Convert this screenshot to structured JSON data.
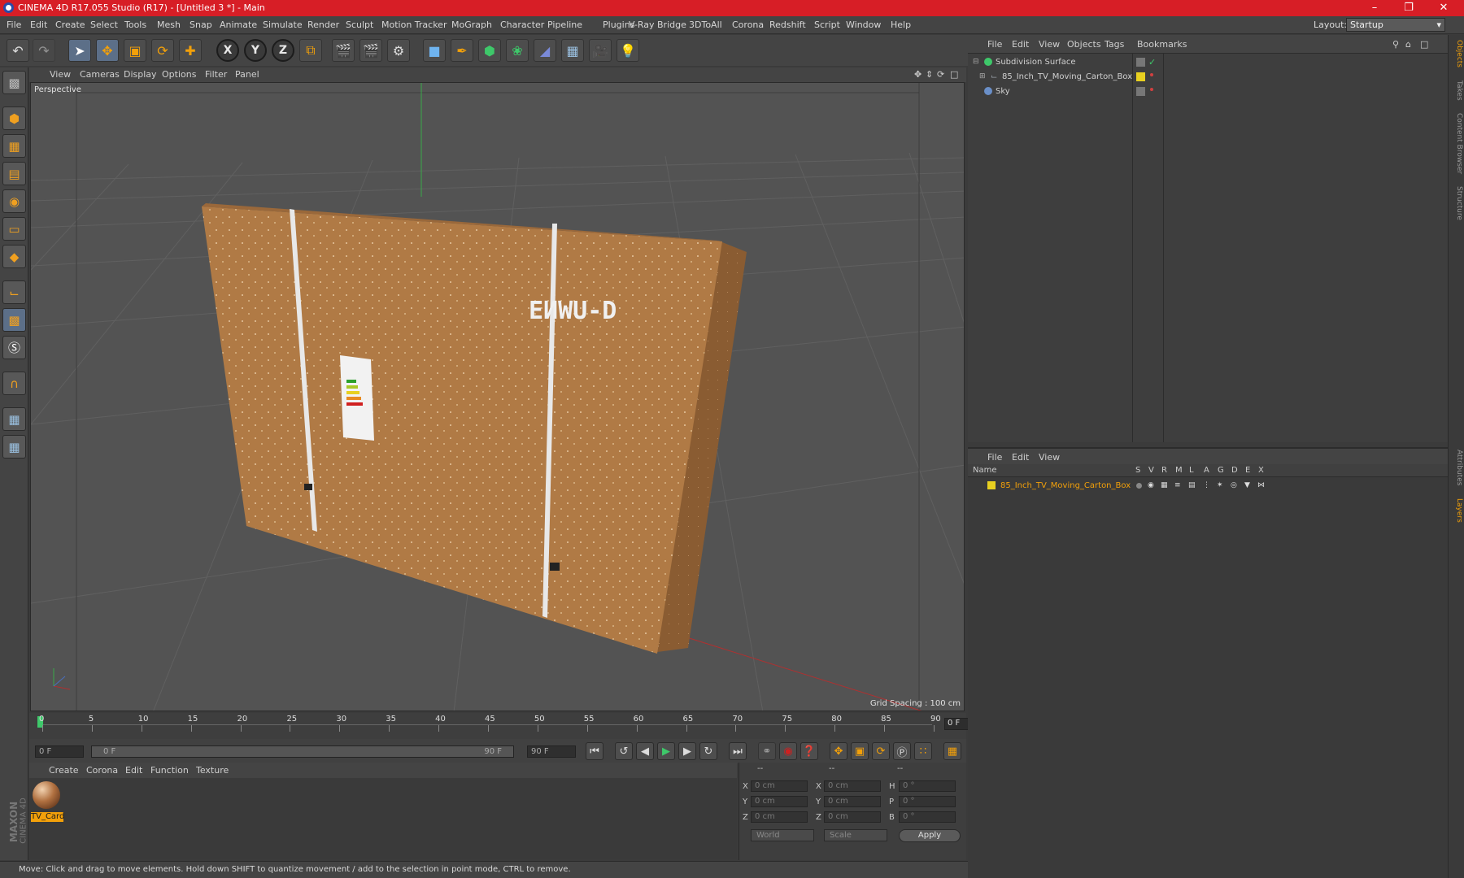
{
  "window": {
    "title": "CINEMA 4D R17.055 Studio (R17) - [Untitled 3 *] - Main"
  },
  "menu": [
    "File",
    "Edit",
    "Create",
    "Select",
    "Tools",
    "Mesh",
    "Snap",
    "Animate",
    "Simulate",
    "Render",
    "Sculpt",
    "Motion Tracker",
    "MoGraph",
    "Character",
    "Pipeline",
    "Plugins",
    "V-Ray Bridge",
    "3DToAll",
    "Corona",
    "Redshift",
    "Script",
    "Window",
    "Help"
  ],
  "layout": {
    "label": "Layout:",
    "value": "Startup"
  },
  "toolbar": {
    "axis_x": "X",
    "axis_y": "Y",
    "axis_z": "Z"
  },
  "viewport": {
    "menu": [
      "View",
      "Cameras",
      "Display",
      "Options",
      "Filter",
      "Panel"
    ],
    "camera": "Perspective",
    "grid_spacing": "Grid Spacing : 100 cm",
    "carton_print": "ΕИWU-D"
  },
  "timeline": {
    "ticks": [
      "0",
      "5",
      "10",
      "15",
      "20",
      "25",
      "30",
      "35",
      "40",
      "45",
      "50",
      "55",
      "60",
      "65",
      "70",
      "75",
      "80",
      "85",
      "90"
    ],
    "current_frame": "0 F",
    "start": "0 F",
    "range_start": "0 F",
    "range_end": "90 F",
    "end": "90 F"
  },
  "material_manager": {
    "menu": [
      "Create",
      "Corona",
      "Edit",
      "Function",
      "Texture"
    ],
    "materials": [
      {
        "name": "TV_Card"
      }
    ]
  },
  "coordinates": {
    "headers": [
      "--",
      "--",
      "--"
    ],
    "rows": [
      {
        "a": "X",
        "av": "0 cm",
        "b": "X",
        "bv": "0 cm",
        "c": "H",
        "cv": "0 °"
      },
      {
        "a": "Y",
        "av": "0 cm",
        "b": "Y",
        "bv": "0 cm",
        "c": "P",
        "cv": "0 °"
      },
      {
        "a": "Z",
        "av": "0 cm",
        "b": "Z",
        "bv": "0 cm",
        "c": "B",
        "cv": "0 °"
      }
    ],
    "mode": "World",
    "scale": "Scale",
    "apply": "Apply"
  },
  "object_manager": {
    "menu": [
      "File",
      "Edit",
      "View",
      "Objects",
      "Tags",
      "Bookmarks"
    ],
    "objects": [
      {
        "name": "Subdivision Surface",
        "color": "#3ec86a"
      },
      {
        "name": "85_Inch_TV_Moving_Carton_Box",
        "color": "#9aa0a8"
      },
      {
        "name": "Sky",
        "color": "#6a8fc8"
      }
    ]
  },
  "layer_manager": {
    "menu": [
      "File",
      "Edit",
      "View"
    ],
    "columns": [
      "Name",
      "S",
      "V",
      "R",
      "M",
      "L",
      "A",
      "G",
      "D",
      "E",
      "X"
    ],
    "layers": [
      {
        "name": "85_Inch_TV_Moving_Carton_Box",
        "color": "#e8d020"
      }
    ]
  },
  "right_tabs": [
    "Objects",
    "Takes",
    "Content Browser",
    "Structure",
    "Attributes",
    "Layers"
  ],
  "branding": {
    "maxon": "MAXON",
    "c4d": "CINEMA 4D"
  },
  "status": "Move: Click and drag to move elements. Hold down SHIFT to quantize movement / add to the selection in point mode, CTRL to remove.",
  "colors": {
    "accent": "#f2a00a",
    "titlebar": "#d71e26",
    "carton": "#b07a45"
  }
}
